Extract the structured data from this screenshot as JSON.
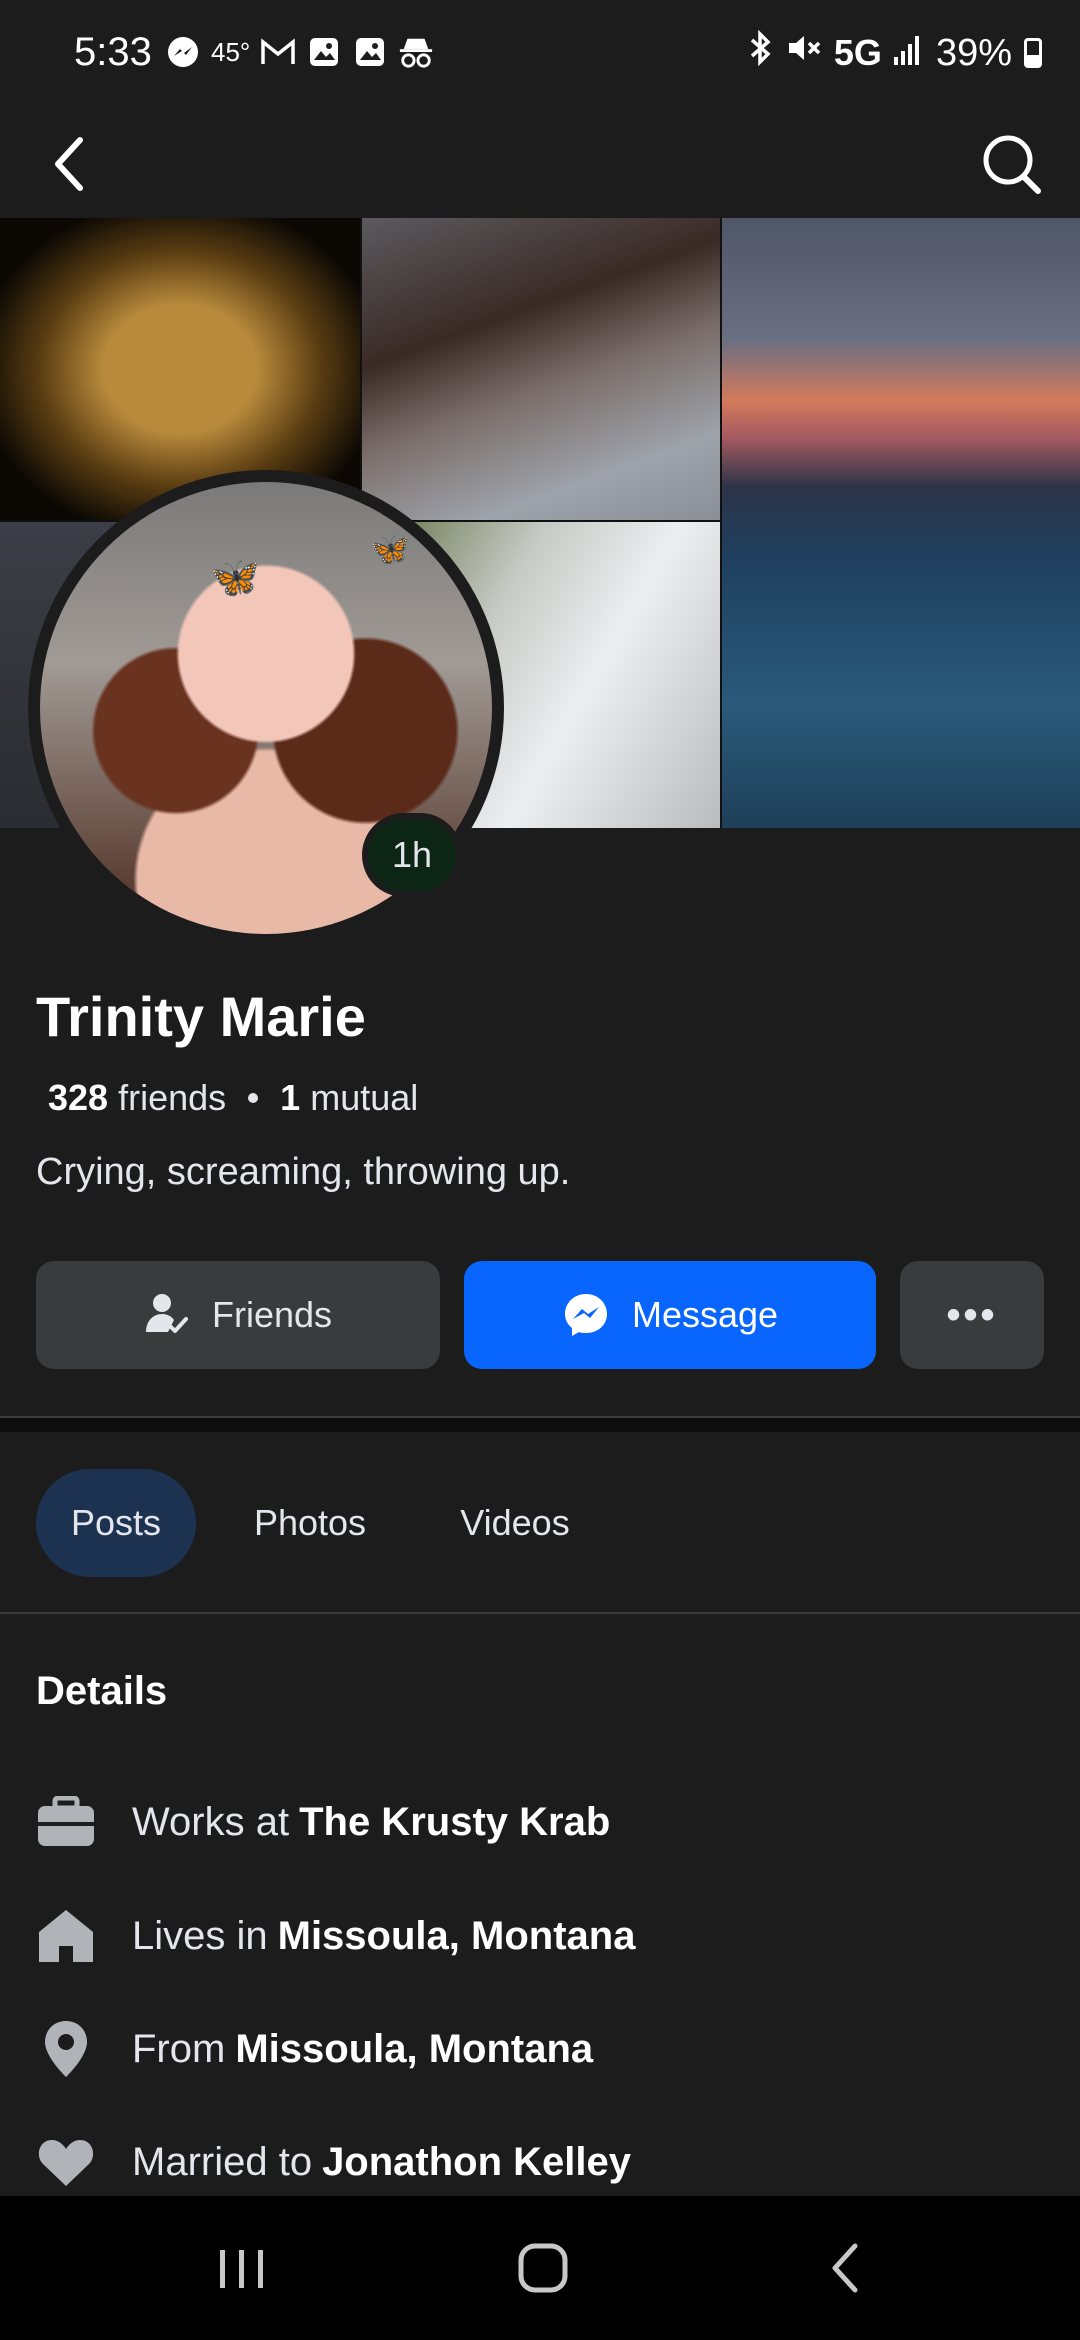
{
  "status_bar": {
    "time": "5:33",
    "temperature": "45°",
    "network": "5G",
    "battery": "39%",
    "left_icons": [
      "messenger-icon",
      "gmail-icon",
      "gallery-icon",
      "gallery-icon",
      "incognito-icon"
    ],
    "right_icons": [
      "bluetooth-icon",
      "mute-icon",
      "signal-icon",
      "battery-icon"
    ]
  },
  "top_nav": {
    "back_icon": "chevron-left-icon",
    "search_icon": "search-icon"
  },
  "profile": {
    "story_badge": "1h",
    "name": "Trinity Marie",
    "friends_count": "328",
    "friends_label": "friends",
    "mutual_count": "1",
    "mutual_label": "mutual",
    "bio": "Crying, screaming, throwing up."
  },
  "actions": {
    "friends_label": "Friends",
    "message_label": "Message",
    "more_label": "•••"
  },
  "tabs": [
    {
      "label": "Posts",
      "active": true
    },
    {
      "label": "Photos",
      "active": false
    },
    {
      "label": "Videos",
      "active": false
    }
  ],
  "details": {
    "title": "Details",
    "work": {
      "prefix": "Works at",
      "value": "The Krusty Krab",
      "icon": "briefcase-icon"
    },
    "lives": {
      "prefix": "Lives in",
      "value": "Missoula, Montana",
      "icon": "home-icon"
    },
    "from": {
      "prefix": "From",
      "value": "Missoula, Montana",
      "icon": "location-pin-icon"
    },
    "married": {
      "prefix": "Married to",
      "value": "Jonathon Kelley",
      "icon": "heart-icon"
    }
  },
  "colors": {
    "background": "#1c1c1d",
    "primary_button": "#0866ff",
    "secondary_button": "#3a3b3c",
    "active_tab": "#1c3250",
    "story_badge": "#0d2515"
  },
  "nav_bar": {
    "icons": [
      "recent-apps-icon",
      "home-button-icon",
      "back-icon"
    ]
  }
}
